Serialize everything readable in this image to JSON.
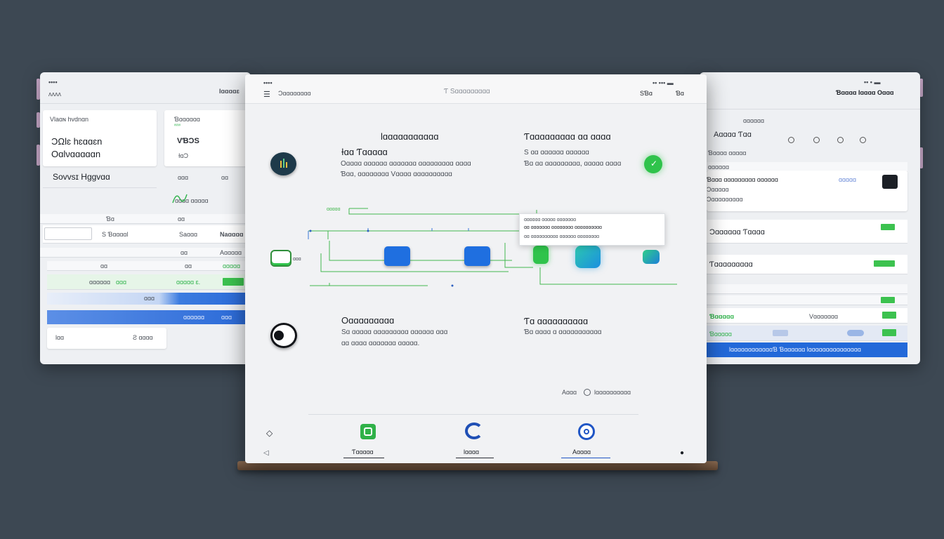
{
  "left_panel": {
    "status": "••••",
    "app_label": "ᴧᴧᴧᴧ",
    "header_right": "Ɩɑɑɑɑɛ",
    "card1_small": "Vlaɑɴ hvdnɑn",
    "card1_line1": "ƆΩƖɛ hɛɑɑɛn",
    "card1_line2": "Oɑlνɑɑɑɑɑn",
    "card2_small": "Ɓɑɑɑɑɑɑ",
    "card2_small2": "ᵛᵛᵛᵛ",
    "card2_line1": "VƁƆS",
    "card2_line2": "ƗɑƆ",
    "subtitle": "Sovvsɪ Hɡɡvɑɑ",
    "val1": "ɑɑɑ",
    "val2": "ɑɑ",
    "green_row": "ɑɑɑɑ ɑɑɑɑɑ",
    "row_a1": "Ɓɑ",
    "row_a2": "ɑɑ",
    "row_b1": "S ƁɑɑɑɑƖ",
    "row_b2": "Saɑɑɑ",
    "row_b3": "Naɑɑɑɑ",
    "row_c1": "ɑɑ",
    "row_c2": "Aɑɑɑɑɑ",
    "row_d1": "ɑɑ",
    "row_d2": "ɑɑ",
    "row_d3": "ɑɑɑɑɑ",
    "row_e1": "ɑɑɑɑɑɑ",
    "row_e2": "ɑɑɑ",
    "row_e3": "ɑɑɑɑɑ ɛ.",
    "row_f1": "ɑɑɑ",
    "row_g1": "ɑɑɑɑɑɑ",
    "row_g2": "ɑɑɑ",
    "foot_left": "Ɩɑɑ",
    "foot_right": "Ƨ ɑɑɑɑ"
  },
  "main": {
    "status": "••••",
    "status_right": "•• ••• ▬",
    "menu_label": "Ɔɑɑɑɑɑɑɑɑ",
    "center_title": "Ƭ Sɑɑɑɑɑɑɑɑɑ",
    "right_label1": "SƁɑ",
    "right_label2": "Ɓɑ",
    "heading_left": "Ɩɑɑɑɑɑɑɑɑɑɑɑ",
    "heading_right": "Ƭɑɑɑɑɑɑɑɑɑ ɑɑ ɑɑɑɑ",
    "sec1_title": "Ɨɑɑ Ƭɑɑɑɑɑ",
    "sec1_line1": "Oɑɑɑɑ ɑɑɑɑɑɑ ɑɑɑɑɑɑɑ ɑɑɑɑɑɑɑɑɑ ɑɑɑɑ",
    "sec1_line2": "Ɓɑɑ,  ɑɑɑɑɑɑɑɑ Vɑɑɑɑ ɑɑɑɑɑɑɑɑɑɑ",
    "sec1r_line1": "S ɑɑ ɑɑɑɑɑɑ ɑɑɑɑɑɑ",
    "sec1r_line2": "Ɓɑ  ɑɑ  ɑɑɑɑɑɑɑɑɑ,  ɑɑɑɑɑ ɑɑɑɑ",
    "diagram_left_label": "ɑɑɑ",
    "diagram_small1": "ɑɑɑɑɑ",
    "popup_line1": "ɑɑɑɑɑɑ ɑɑɑɑɑ ɑɑɑɑɑɑɑ",
    "popup_line2": "ɑɑ  ɑɑɑɑɑɑɑ ɑɑɑɑɑɑɑɑ ɑɑɑɑɑɑɑɑɑɑ",
    "popup_line3": "ɑɑ  ɑɑɑɑɑɑɑɑɑɑ ɑɑɑɑɑɑ ɑɑɑɑɑɑɑɑ",
    "sec2_title": "Oɑɑɑɑɑɑɑɑɑ",
    "sec2_line1": "Sɑ ɑɑɑɑɑ ɑɑɑɑɑɑɑɑɑ ɑɑɑɑɑɑ ɑɑɑ",
    "sec2_line2": "ɑɑ  ɑɑɑɑ ɑɑɑɑɑɑɑ ɑɑɑɑɑ.",
    "sec2r_title": "Ƭɑ ɑɑɑɑɑɑɑɑɑɑ",
    "sec2r_line1": "Ɓɑ ɑɑɑɑ ɑ ɑɑɑɑɑɑɑɑɑɑɑ",
    "foot_opt1": "Aɑɑɑ",
    "foot_opt2": "Ɩɑɑɑɑɑɑɑɑɑɑ",
    "tab1": "Ƭɑɑɑɑɑ",
    "tab2": "Ɩɑɑɑɑ",
    "tab3": "Aɑɑɑɑ"
  },
  "right_panel": {
    "status": "•• • ▬",
    "header_right": "Ɓɑɑɑɑ Ɩɑɑɑɑ Oɑɑɑ",
    "header_small": "ɑɑɑɑɑɑ",
    "title": "Aɑɑɑɑ Ƭɑɑ",
    "sub": "Ɓɑɑɑɑ ɑɑɑɑɑ",
    "tag": "ɑɑɑɑɑɑ",
    "row1_a": "Ɓɑɑɑ ɑɑɑɑɑɑɑɑɑ ɑɑɑɑɑɑ",
    "row1_b": "Ɔɑɑɑɑɑ",
    "row1_c": "Ɔɑɑɑɑɑɑɑɑɑ",
    "row1_right": "ɑɑɑɑɑ",
    "row2": "Ɔɑɑɑɑɑɑ Ƭɑɑɑɑ",
    "row3": "Ƭɑɑɑɑɑɑɑɑɑ",
    "row4_a": "Ɓɑɑɑɑɑ",
    "row4_b": "Vɑɑɑɑɑɑɑ",
    "row5": "Ɓɑɑɑɑɑ",
    "banner": "ƖɑɑɑɑɑɑɑɑɑɑɑɑƁ Ɓɑɑɑɑɑɑ Ɩɑɑɑɑɑɑɑɑɑɑɑɑɑɑɑ"
  }
}
